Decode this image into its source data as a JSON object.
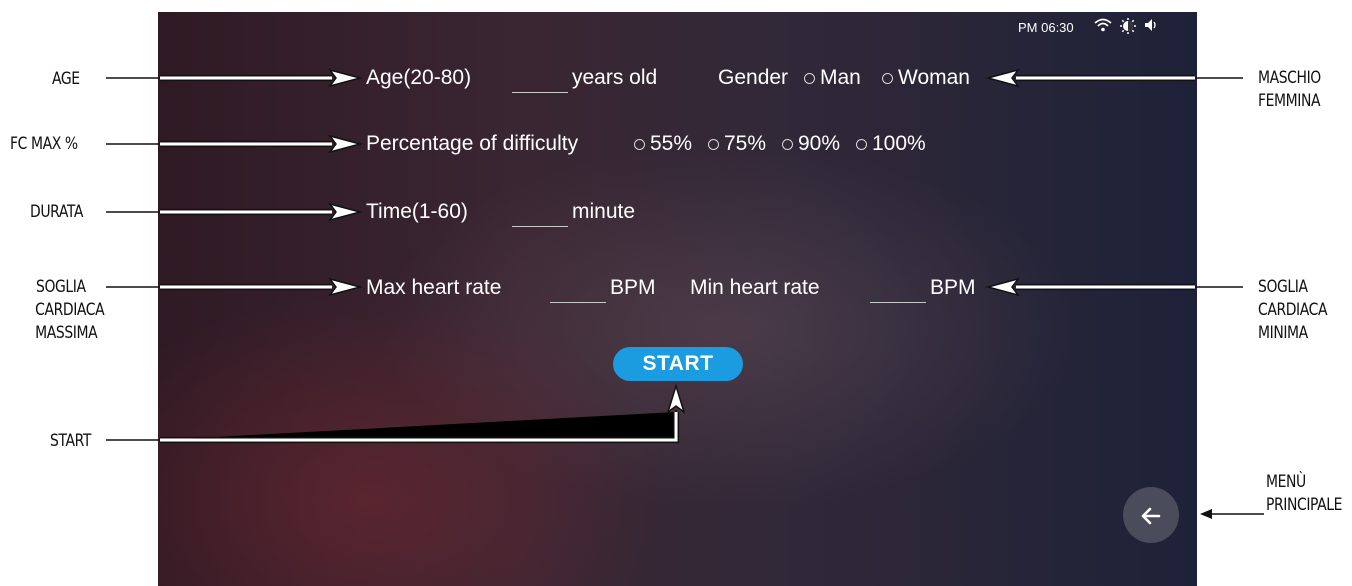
{
  "status_bar": {
    "time": "PM 06:30",
    "icons": [
      "wifi-icon",
      "brightness-icon",
      "volume-icon"
    ]
  },
  "form": {
    "age_label": "Age(20-80)",
    "age_unit": "years old",
    "gender_label": "Gender",
    "gender_options": [
      "Man",
      "Woman"
    ],
    "difficulty_label": "Percentage of difficulty",
    "difficulty_options": [
      "55%",
      "75%",
      "90%",
      "100%"
    ],
    "time_label": "Time(1-60)",
    "time_unit": "minute",
    "max_hr_label": "Max heart rate",
    "max_hr_unit": "BPM",
    "min_hr_label": "Min heart rate",
    "min_hr_unit": "BPM",
    "start_label": "START"
  },
  "annotations": {
    "age": "AGE",
    "fc_max": "FC MAX %",
    "durata": "DURATA",
    "soglia_max": [
      "SOGLIA",
      "CARDIACA",
      "MASSIMA"
    ],
    "start": "START",
    "maschio_femmina": [
      "MASCHIO",
      "FEMMINA"
    ],
    "soglia_min": [
      "SOGLIA",
      "CARDIACA",
      "MINIMA"
    ],
    "menu": [
      "MENÙ",
      "PRINCIPALE"
    ]
  },
  "colors": {
    "accent": "#1b9be0",
    "annotation_text": "#111111"
  }
}
